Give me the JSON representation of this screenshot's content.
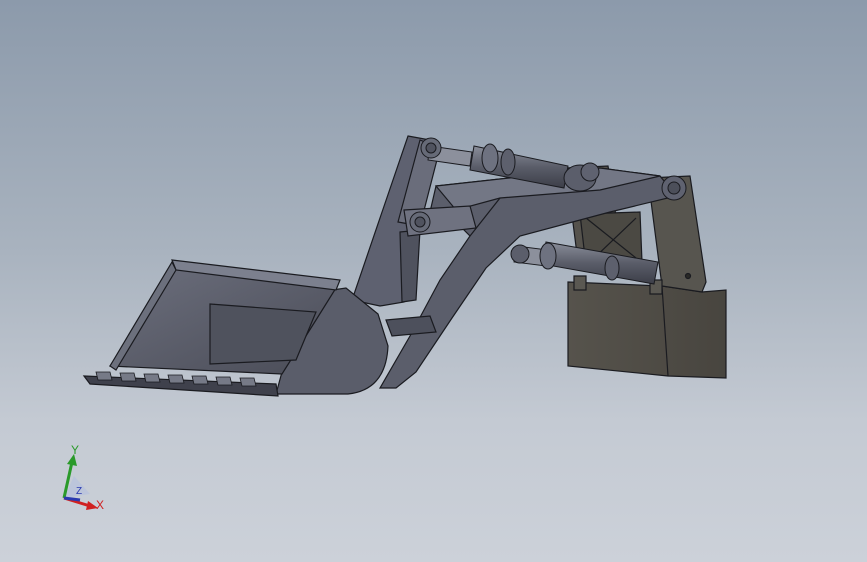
{
  "viewport": {
    "background_top": "#8c9aab",
    "background_bottom": "#ccd1d9"
  },
  "model": {
    "part_color": "#5b5e6b",
    "part_dark": "#3f414c",
    "part_light": "#7a7e8c",
    "edge_color": "#1a1b20",
    "mount_color": "#535049"
  },
  "triad": {
    "x_label": "X",
    "y_label": "Y",
    "z_label": "Z",
    "x_color": "#d02020",
    "y_color": "#2a9a2a",
    "z_color": "#2a3ab0"
  }
}
